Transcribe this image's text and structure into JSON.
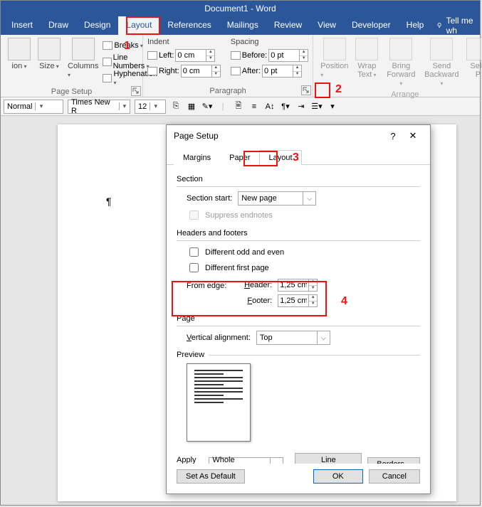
{
  "app": {
    "title": "Document1 - Word"
  },
  "tabs": {
    "insert": "Insert",
    "draw": "Draw",
    "design": "Design",
    "layout": "Layout",
    "references": "References",
    "mailings": "Mailings",
    "review": "Review",
    "view": "View",
    "developer": "Developer",
    "help": "Help",
    "tellme": "Tell me wh"
  },
  "ribbon": {
    "pagesetup": {
      "label": "Page Setup",
      "orientation_suffix": "ion",
      "size": "Size",
      "columns": "Columns",
      "breaks": "Breaks",
      "line_numbers": "Line Numbers",
      "hyphenation": "Hyphenation"
    },
    "paragraph": {
      "label": "Paragraph",
      "indent": "Indent",
      "left": "Left:",
      "right": "Right:",
      "left_val": "0 cm",
      "right_val": "0 cm",
      "spacing": "Spacing",
      "before": "Before:",
      "after": "After:",
      "before_val": "0 pt",
      "after_val": "0 pt"
    },
    "arrange": {
      "label": "Arrange",
      "position": "Position",
      "wrap": "Wrap Text",
      "bring": "Bring Forward",
      "send": "Send Backward",
      "selection": "Sele P"
    }
  },
  "toolbar2": {
    "style": "Normal",
    "font": "Times New R",
    "size": "12"
  },
  "dialog": {
    "title": "Page Setup",
    "tabs": {
      "margins": "Margins",
      "paper": "Paper",
      "layout": "Layout"
    },
    "section": {
      "label": "Section",
      "start_label": "Section start:",
      "start_val": "New page",
      "suppress": "Suppress endnotes"
    },
    "hf": {
      "label": "Headers and footers",
      "odd_even": "Different odd and even",
      "first_page": "Different first page",
      "from_edge": "From edge:",
      "header": "Header:",
      "header_val": "1,25 cm",
      "footer": "Footer:",
      "footer_val": "1,25 cm"
    },
    "page": {
      "label": "Page",
      "valign": "Vertical alignment:",
      "valign_val": "Top"
    },
    "preview": "Preview",
    "apply_to": "Apply to:",
    "apply_to_val": "Whole document",
    "line_numbers_btn": "Line Numbers...",
    "borders_btn": "Borders...",
    "set_default": "Set As Default",
    "ok": "OK",
    "cancel": "Cancel"
  },
  "callouts": {
    "1": "1",
    "2": "2",
    "3": "3",
    "4": "4"
  },
  "doc": {
    "paragraph_mark": "¶"
  }
}
